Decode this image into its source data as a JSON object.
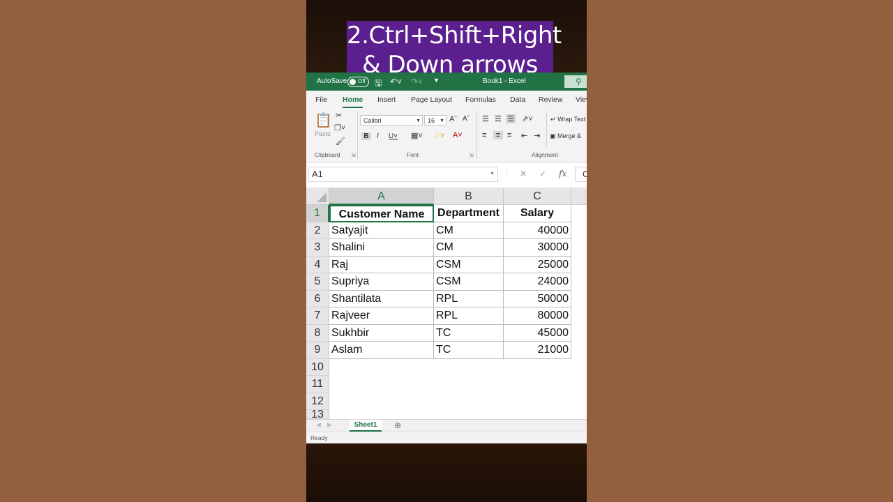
{
  "caption": {
    "line1": "2.Ctrl+Shift+Right",
    "line2": "& Down arrows"
  },
  "titlebar": {
    "autosave": "AutoSave",
    "toggle": "Off",
    "title": "Book1  -  Excel"
  },
  "tabs": [
    "File",
    "Home",
    "Insert",
    "Page Layout",
    "Formulas",
    "Data",
    "Review",
    "View"
  ],
  "ribbon": {
    "paste": "Paste",
    "font_name": "Calibri",
    "font_size": "16",
    "wrap_text": "Wrap Text",
    "merge": "Merge &",
    "groups": {
      "clipboard": "Clipboard",
      "font": "Font",
      "alignment": "Alignment"
    }
  },
  "formula_bar": {
    "name_box": "A1",
    "fx": "fx",
    "content": "C"
  },
  "columns": [
    "A",
    "B",
    "C"
  ],
  "rows": [
    "1",
    "2",
    "3",
    "4",
    "5",
    "6",
    "7",
    "8",
    "9",
    "10",
    "11",
    "12",
    "13"
  ],
  "table": {
    "headers": [
      "Customer Name",
      "Department",
      "Salary"
    ],
    "data": [
      [
        "Satyajit",
        "CM",
        "40000"
      ],
      [
        "Shalini",
        "CM",
        "30000"
      ],
      [
        "Raj",
        "CSM",
        "25000"
      ],
      [
        "Supriya",
        "CSM",
        "24000"
      ],
      [
        "Shantilata",
        "RPL",
        "50000"
      ],
      [
        "Rajveer",
        "RPL",
        "80000"
      ],
      [
        "Sukhbir",
        "TC",
        "45000"
      ],
      [
        "Aslam",
        "TC",
        "21000"
      ]
    ]
  },
  "sheet_tab": "Sheet1",
  "status": "Ready",
  "colors": {
    "excel_green": "#217346",
    "caption_bg": "#5b1f8f"
  }
}
